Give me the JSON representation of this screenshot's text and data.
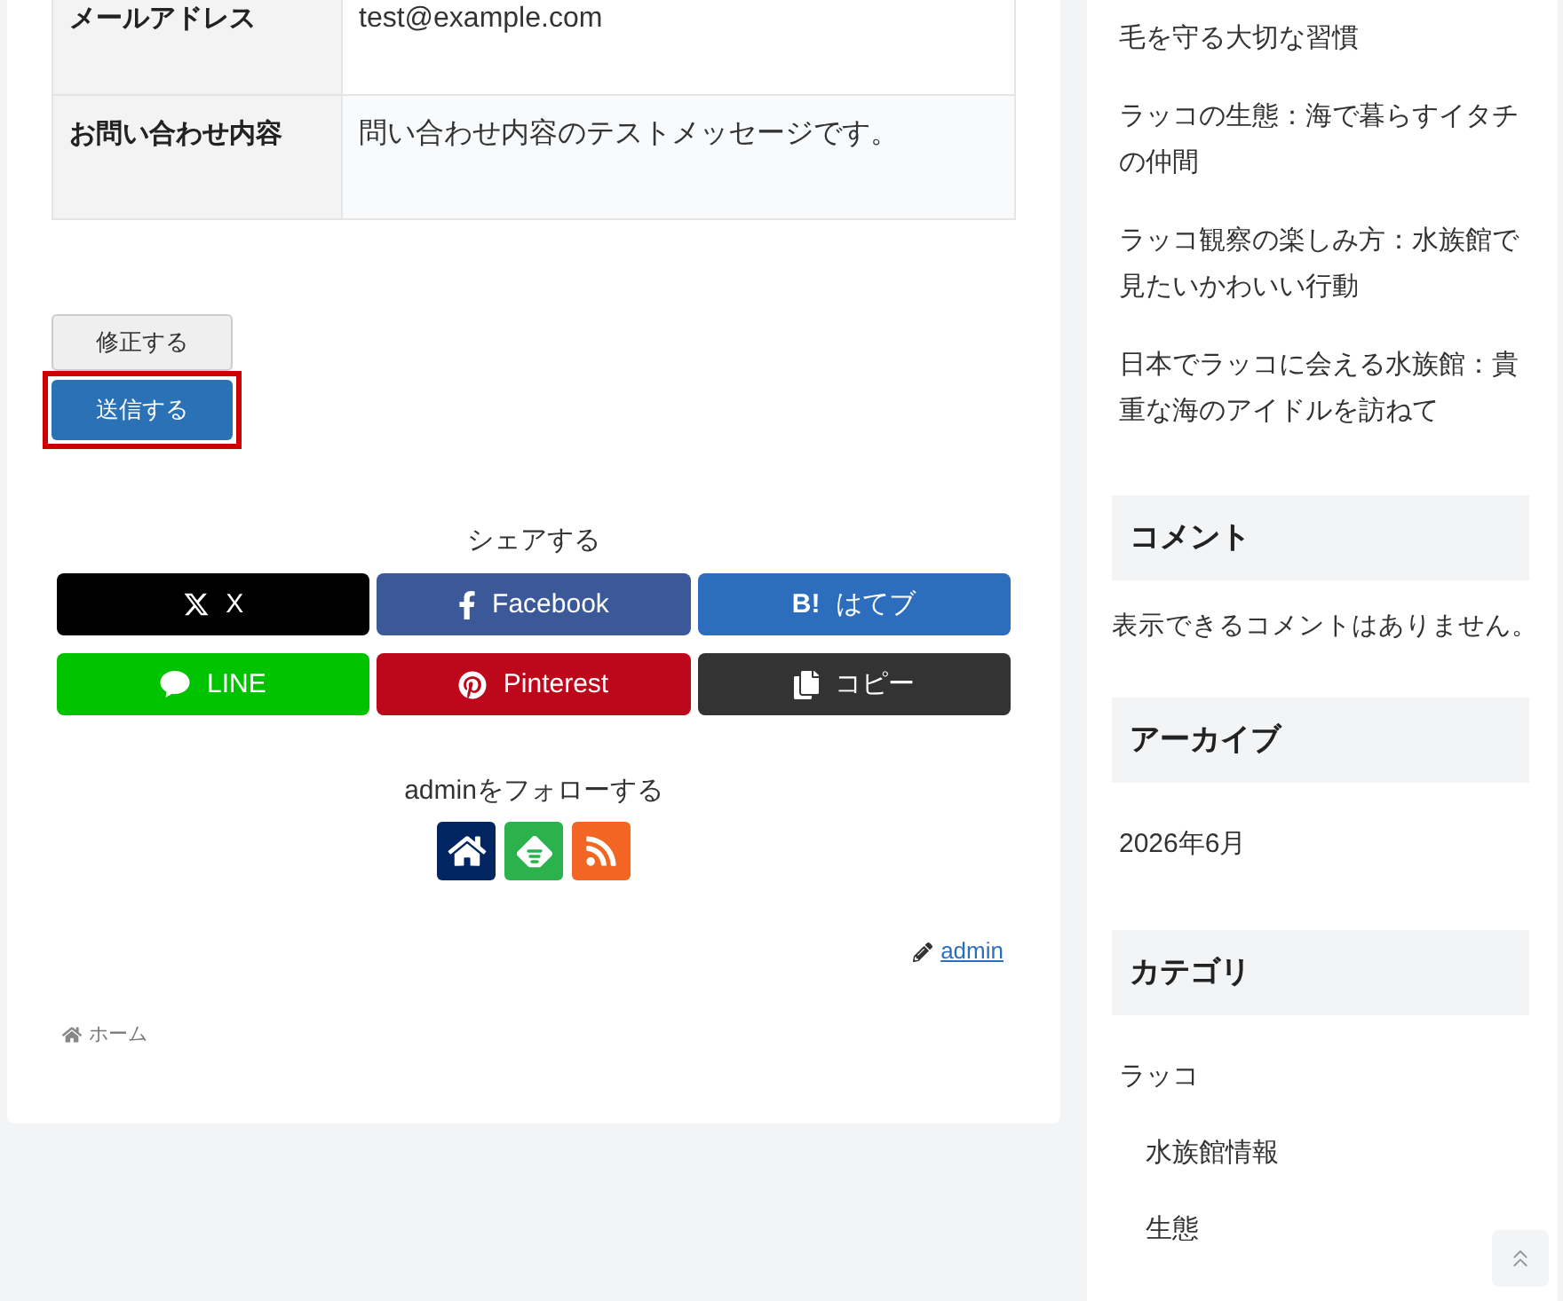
{
  "contact_table": {
    "rows": [
      {
        "label": "メールアドレス",
        "value": "test@example.com"
      },
      {
        "label": "お問い合わせ内容",
        "value": "問い合わせ内容のテストメッセージです。"
      }
    ]
  },
  "form_buttons": [
    {
      "label": "修正する",
      "kind": "secondary",
      "highlighted": false
    },
    {
      "label": "送信する",
      "kind": "primary",
      "highlighted": true
    }
  ],
  "share": {
    "heading": "シェアする",
    "buttons": [
      {
        "kind": "x",
        "label": "X",
        "color": "#000000"
      },
      {
        "kind": "facebook",
        "label": "Facebook",
        "color": "#3b5998"
      },
      {
        "kind": "hatena",
        "icon": "B!",
        "label": "はてブ",
        "color": "#2c6ebd"
      },
      {
        "kind": "line",
        "label": "LINE",
        "color": "#00c300"
      },
      {
        "kind": "pinterest",
        "label": "Pinterest",
        "color": "#bd081c"
      },
      {
        "kind": "copy",
        "label": "コピー",
        "color": "#333333"
      }
    ]
  },
  "follow": {
    "heading": "adminをフォローする",
    "buttons": [
      {
        "kind": "home",
        "color": "#002561"
      },
      {
        "kind": "feedly",
        "color": "#2bb24c"
      },
      {
        "kind": "rss",
        "color": "#f26522"
      }
    ]
  },
  "author_link": {
    "name": "admin"
  },
  "breadcrumb": [
    {
      "label": "ホーム"
    }
  ],
  "sidebar": {
    "recent_posts": [
      {
        "title": "毛を守る大切な習慣"
      },
      {
        "title": "ラッコの生態：海で暮らすイタチの仲間"
      },
      {
        "title": "ラッコ観察の楽しみ方：水族館で見たいかわいい行動"
      },
      {
        "title": "日本でラッコに会える水族館：貴重な海のアイドルを訪ねて"
      }
    ],
    "comments": {
      "heading": "コメント",
      "text": "表示できるコメントはありません。"
    },
    "archive": {
      "heading": "アーカイブ",
      "items": [
        {
          "label": "2026年6月"
        }
      ]
    },
    "categories": {
      "heading": "カテゴリ",
      "items": [
        {
          "label": "ラッコ",
          "children": [
            {
              "label": "水族館情報"
            },
            {
              "label": "生態"
            }
          ]
        }
      ]
    }
  }
}
